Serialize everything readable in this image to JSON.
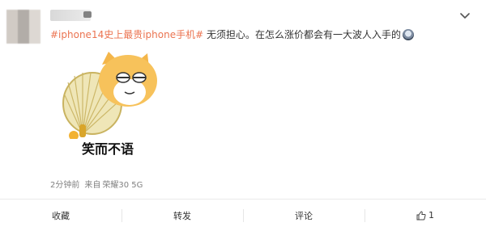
{
  "post": {
    "hashtag": "#iphone14史上最贵iphone手机#",
    "text": " 无须担心。在怎么涨价都会有一大波人入手的",
    "sticker_caption": "笑而不语",
    "meta": {
      "time": "2分钟前",
      "source_prefix": "来自",
      "source": "荣耀30 5G"
    }
  },
  "actions": {
    "favorite": "收藏",
    "repost": "转发",
    "comment": "评论",
    "like_count": "1"
  },
  "icons": {
    "more": "chevron-down-icon",
    "like": "thumbs-up-icon",
    "inline_emoji": "face-emoji-icon"
  },
  "colors": {
    "hashtag": "#eb7350",
    "meta": "#808080",
    "divider": "#eaeaea"
  }
}
